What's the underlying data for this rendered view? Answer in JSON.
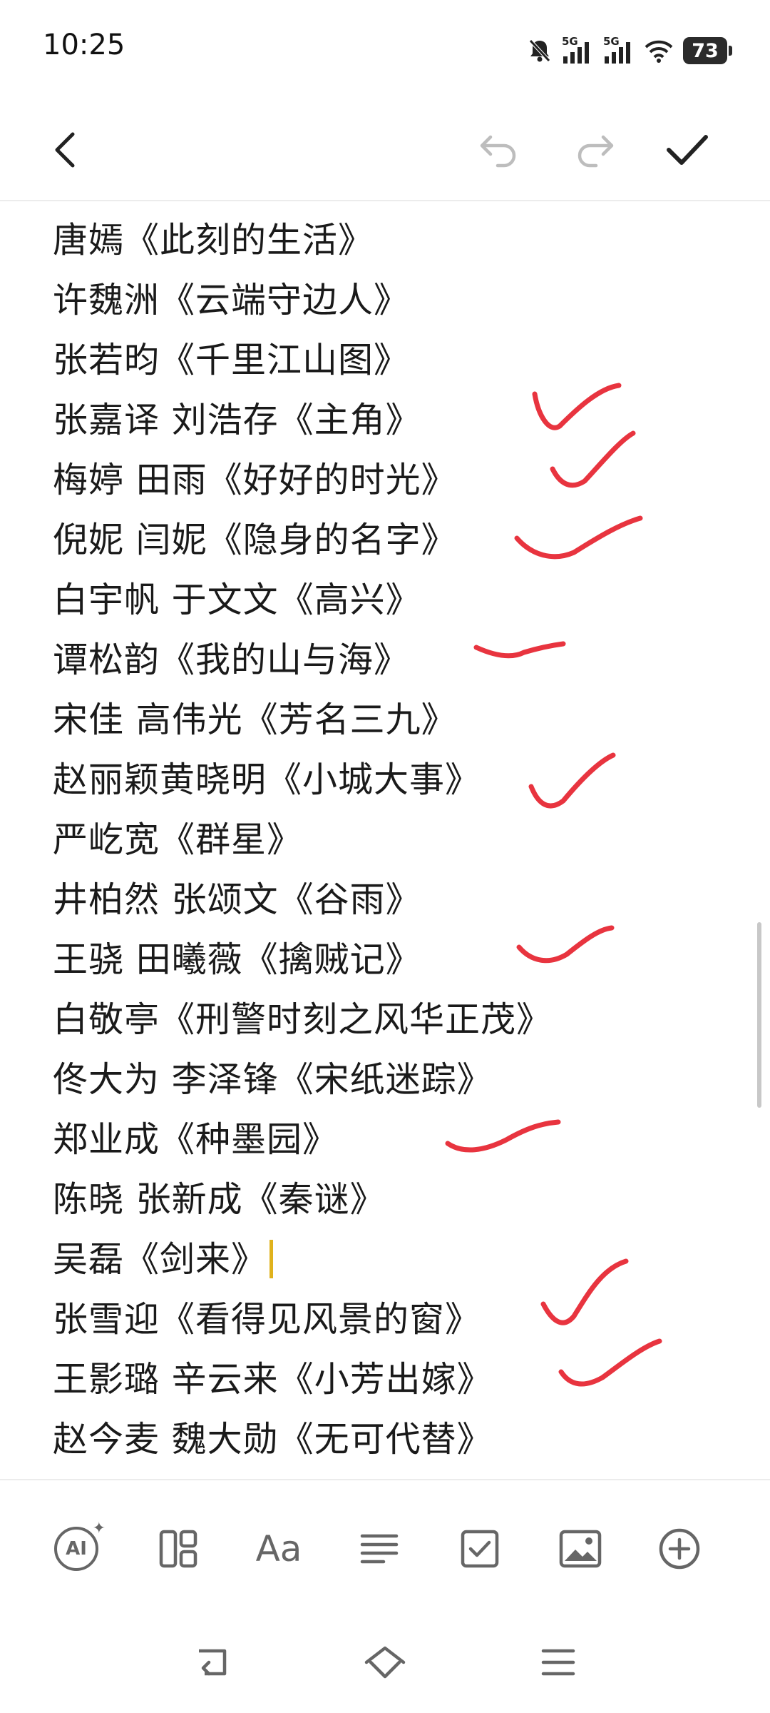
{
  "status_bar": {
    "time": "10:25",
    "battery": "73",
    "signal_1_label": "5G",
    "signal_2_label": "5G",
    "icons": [
      "mute-bell-icon",
      "signal-5g-icon",
      "signal-5g-icon",
      "wifi-icon",
      "battery-icon"
    ]
  },
  "header": {
    "icons": [
      "back-arrow-icon",
      "undo-icon",
      "redo-icon",
      "checkmark-icon"
    ]
  },
  "note": {
    "lines": [
      "唐嫣《此刻的生活》",
      "许魏洲《云端守边人》",
      "张若昀《千里江山图》",
      "张嘉译 刘浩存《主角》",
      "梅婷 田雨《好好的时光》",
      "倪妮 闫妮《隐身的名字》",
      "白宇帆 于文文《高兴》",
      "谭松韵《我的山与海》",
      "宋佳 高伟光《芳名三九》",
      "赵丽颖黄晓明《小城大事》",
      "严屹宽《群星》",
      "井柏然 张颂文《谷雨》",
      "王骁 田曦薇《擒贼记》",
      "白敬亭《刑警时刻之风华正茂》",
      "佟大为 李泽锋《宋纸迷踪》",
      "郑业成《种墨园》",
      "陈晓 张新成《秦谜》",
      "吴磊《剑来》",
      "张雪迎《看得见风景的窗》",
      "王影璐 辛云来《小芳出嫁》",
      "赵今麦 魏大勋《无可代替》"
    ],
    "handwritten_check_color": "#e8343f",
    "caret_color": "#e0b21c"
  },
  "toolbar": {
    "ai_label": "AI",
    "text_format_label": "Aa",
    "icons": [
      "ai-assistant-icon",
      "layout-template-icon",
      "text-format-icon",
      "align-icon",
      "checklist-icon",
      "image-icon",
      "add-icon"
    ]
  },
  "navbar": {
    "icons": [
      "nav-back-icon",
      "nav-home-icon",
      "nav-menu-icon"
    ]
  }
}
